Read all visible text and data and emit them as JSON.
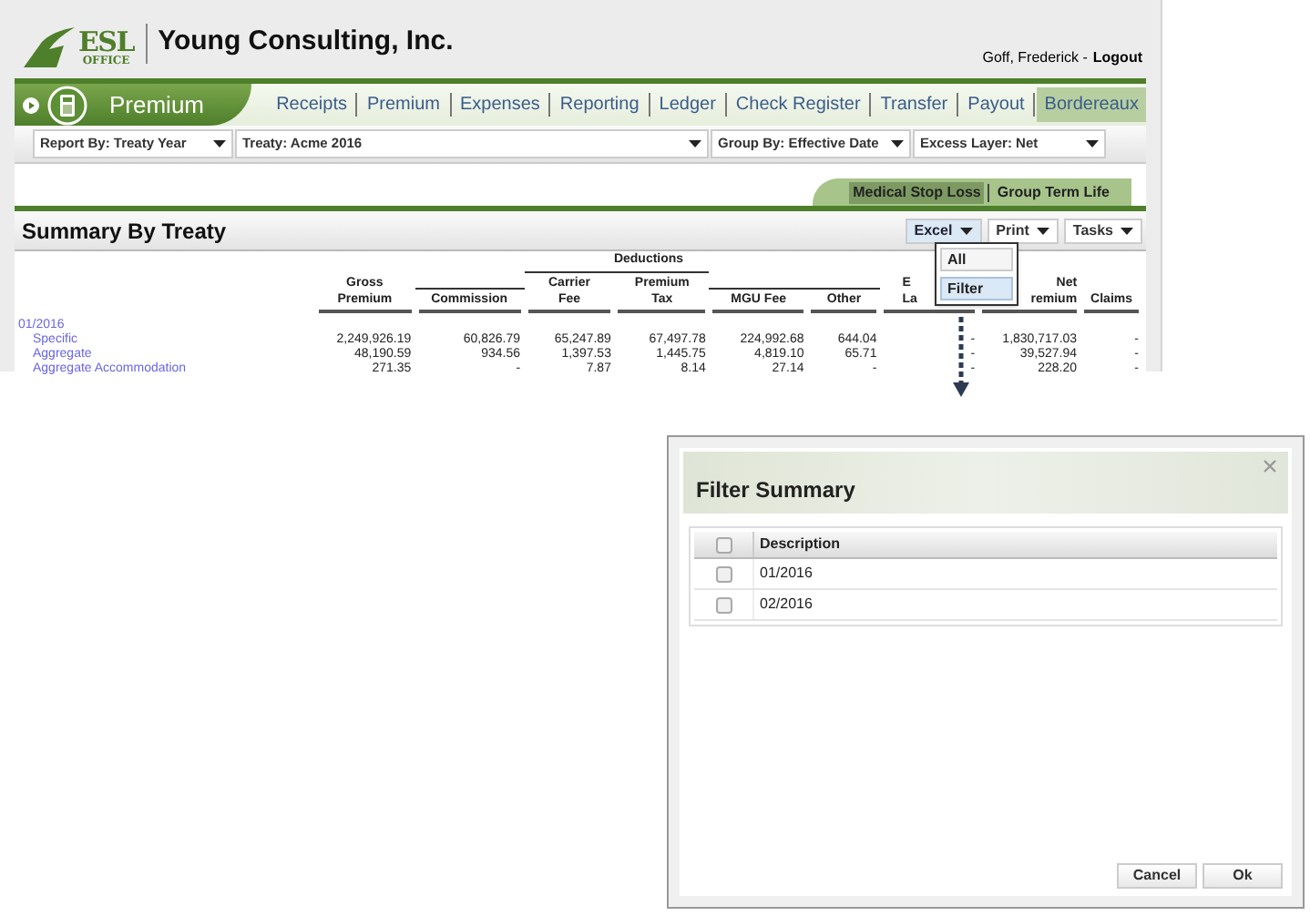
{
  "header": {
    "logo": {
      "mark": "ESL",
      "sub": "OFFICE"
    },
    "company": "Young Consulting, Inc.",
    "user": "Goff, Frederick -",
    "logout": "Logout"
  },
  "module": {
    "title": "Premium"
  },
  "nav": [
    {
      "label": "Receipts",
      "selected": false
    },
    {
      "label": "Premium",
      "selected": false
    },
    {
      "label": "Expenses",
      "selected": false
    },
    {
      "label": "Reporting",
      "selected": false
    },
    {
      "label": "Ledger",
      "selected": false
    },
    {
      "label": "Check Register",
      "selected": false
    },
    {
      "label": "Transfer",
      "selected": false
    },
    {
      "label": "Payout",
      "selected": false
    },
    {
      "label": "Bordereaux",
      "selected": true
    }
  ],
  "filters": [
    {
      "label": "Report By: Treaty Year"
    },
    {
      "label": "Treaty: Acme 2016"
    },
    {
      "label": "Group By: Effective Date"
    },
    {
      "label": "Excess Layer: Net"
    }
  ],
  "subtabs": [
    {
      "label": "Medical Stop Loss",
      "selected": true
    },
    {
      "label": "Group Term Life",
      "selected": false
    }
  ],
  "report": {
    "title": "Summary By Treaty",
    "actions": [
      {
        "label": "Excel",
        "active": true
      },
      {
        "label": "Print",
        "active": false
      },
      {
        "label": "Tasks",
        "active": false
      }
    ],
    "menu": [
      {
        "label": "All",
        "selected": false
      },
      {
        "label": "Filter",
        "selected": true
      }
    ],
    "deductions_label": "Deductions",
    "columns": [
      {
        "lines": [
          "Gross",
          "Premium"
        ],
        "deduction": false
      },
      {
        "lines": [
          "Commission"
        ],
        "deduction": true
      },
      {
        "lines": [
          "Carrier",
          "Fee"
        ],
        "deduction": true
      },
      {
        "lines": [
          "Premium",
          "Tax"
        ],
        "deduction": true
      },
      {
        "lines": [
          "MGU Fee"
        ],
        "deduction": true
      },
      {
        "lines": [
          "Other"
        ],
        "deduction": true
      },
      {
        "lines": [
          "E",
          "La"
        ],
        "deduction": false
      },
      {
        "lines": [
          "Net",
          "remium"
        ],
        "deduction": false
      },
      {
        "lines": [
          "Claims"
        ],
        "deduction": false
      }
    ],
    "groups": [
      {
        "label": "01/2016",
        "rows": [
          {
            "label": "Specific",
            "cells": [
              "2,249,926.19",
              "60,826.79",
              "65,247.89",
              "67,497.78",
              "224,992.68",
              "644.04",
              "-",
              "1,830,717.03",
              "-"
            ]
          },
          {
            "label": "Aggregate",
            "cells": [
              "48,190.59",
              "934.56",
              "1,397.53",
              "1,445.75",
              "4,819.10",
              "65.71",
              "-",
              "39,527.94",
              "-"
            ]
          },
          {
            "label": "Aggregate Accommodation",
            "cells": [
              "271.35",
              "-",
              "7.87",
              "8.14",
              "27.14",
              "-",
              "-",
              "228.20",
              "-"
            ]
          }
        ]
      }
    ]
  },
  "dialog": {
    "title": "Filter Summary",
    "header_checked": false,
    "column": "Description",
    "rows": [
      {
        "label": "01/2016",
        "checked": false
      },
      {
        "label": "02/2016",
        "checked": false
      }
    ],
    "buttons": [
      "Cancel",
      "Ok"
    ]
  }
}
